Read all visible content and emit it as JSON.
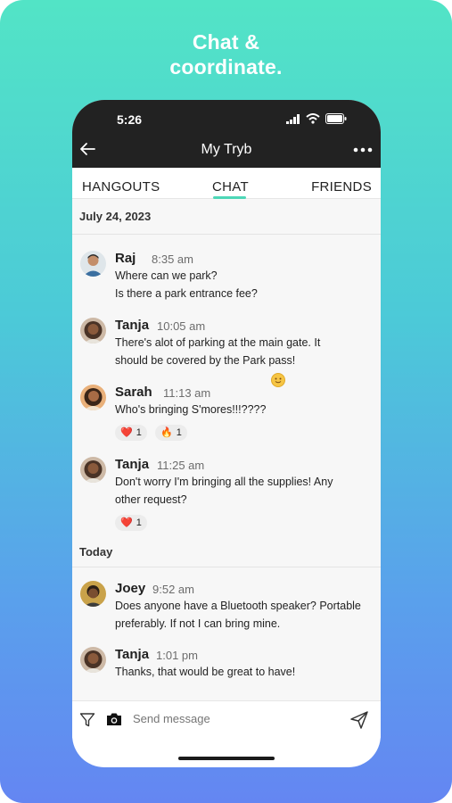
{
  "headline": {
    "line1": "Chat &",
    "line2": "coordinate."
  },
  "status_bar": {
    "time": "5:26",
    "icons": [
      "signal-icon",
      "wifi-icon",
      "battery-icon"
    ]
  },
  "nav": {
    "title": "My Tryb",
    "back_icon": "back-arrow-icon",
    "more_icon": "more-dots-icon"
  },
  "tabs": [
    {
      "label": "HANGOUTS",
      "active": false
    },
    {
      "label": "CHAT",
      "active": true
    },
    {
      "label": "FRIENDS",
      "active": false
    }
  ],
  "colors": {
    "accent": "#4dd7b7",
    "topbar": "#222222",
    "gradient_top": "#52e4c6",
    "gradient_bottom": "#6486f2"
  },
  "chat": {
    "date_1": "July 24, 2023",
    "date_2": "Today",
    "messages": [
      {
        "sender": "Raj",
        "time": "8:35 am",
        "lines": [
          "Where can we park?",
          "Is there a park entrance fee?"
        ]
      },
      {
        "sender": "Tanja",
        "time": "10:05 am",
        "lines": [
          "There's alot of parking at the main gate. It",
          "should be covered by the Park pass!"
        ]
      },
      {
        "sender": "Sarah",
        "time": "11:13 am",
        "lines": [
          "Who's bringing S'mores!!!????"
        ],
        "reactions": [
          {
            "emoji": "❤️",
            "count": "1"
          },
          {
            "emoji": "🔥",
            "count": "1"
          }
        ]
      },
      {
        "sender": "Tanja",
        "time": "11:25 am",
        "lines": [
          "Don't worry I'm bringing all the supplies! Any",
          "other request?"
        ],
        "reactions": [
          {
            "emoji": "❤️",
            "count": "1"
          }
        ]
      },
      {
        "sender": "Joey",
        "time": "9:52 am",
        "lines": [
          "Does anyone have a Bluetooth speaker? Portable",
          "preferably. If not I can bring mine."
        ]
      },
      {
        "sender": "Tanja",
        "time": "1:01 pm",
        "lines": [
          "Thanks, that would be great to have!"
        ]
      }
    ]
  },
  "composer": {
    "placeholder": "Send message"
  }
}
